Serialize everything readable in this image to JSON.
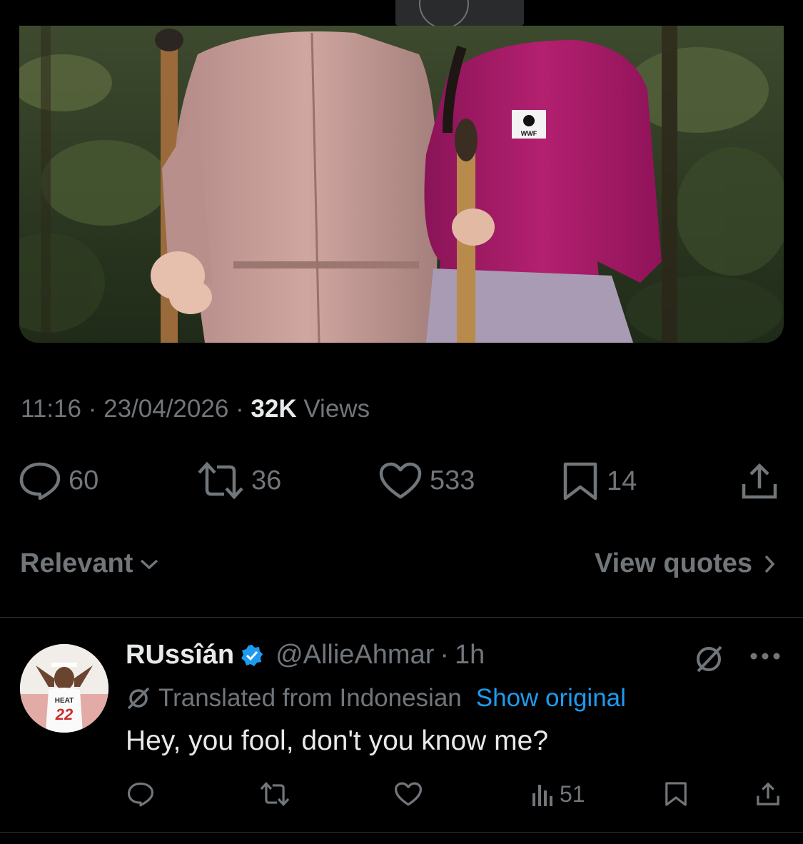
{
  "tweet": {
    "time": "11:16",
    "date": "23/04/2026",
    "views_count": "32K",
    "views_label": "Views",
    "replies": "60",
    "reposts": "36",
    "likes": "533",
    "bookmarks": "14"
  },
  "sort": {
    "label": "Relevant"
  },
  "quotes": {
    "label": "View quotes"
  },
  "reply": {
    "name": "RUssîán",
    "handle": "@AllieAhmar",
    "time": "1h",
    "translated_note": "Translated from Indonesian",
    "show_original": "Show original",
    "text": "Hey, you fool, don't you know me?",
    "views": "51",
    "avatar_jersey": "22",
    "avatar_team": "HEAT"
  },
  "photo": {
    "logo_text": "WWF"
  },
  "colors": {
    "accent": "#1d9bf0",
    "muted": "#71767b",
    "text": "#e7e9ea",
    "background": "#000000"
  },
  "icons": [
    "reply-icon",
    "repost-icon",
    "like-icon",
    "bookmark-icon",
    "share-icon",
    "chevron-down-icon",
    "chevron-right-icon",
    "verified-icon",
    "grok-icon",
    "more-icon",
    "translate-icon",
    "views-icon"
  ]
}
